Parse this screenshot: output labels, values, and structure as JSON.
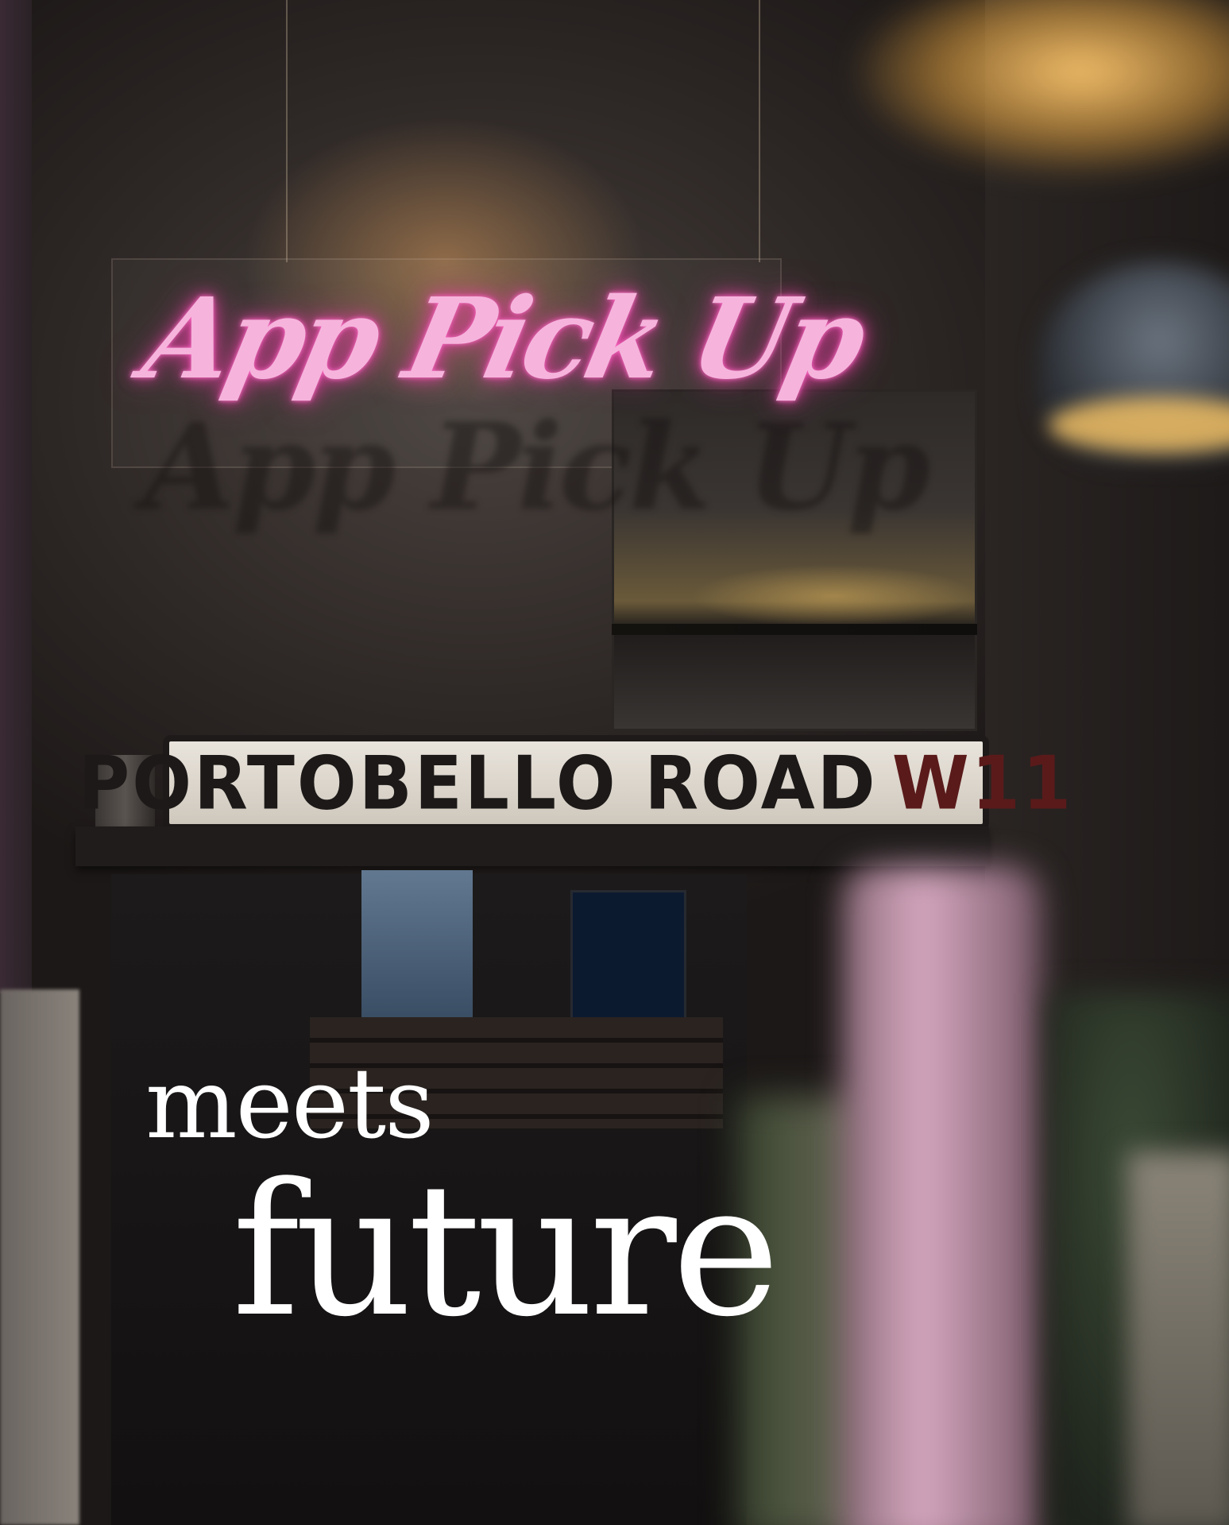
{
  "photo": {
    "neon_sign": "App Pick Up",
    "street_sign": {
      "name": "PORTOBELLO ROAD",
      "district": "W11"
    }
  },
  "headline": {
    "line1": "meets",
    "line2": "future"
  },
  "colors": {
    "neon": "#f6b4dc",
    "headline": "#ffffff",
    "background": "#1a1716"
  }
}
